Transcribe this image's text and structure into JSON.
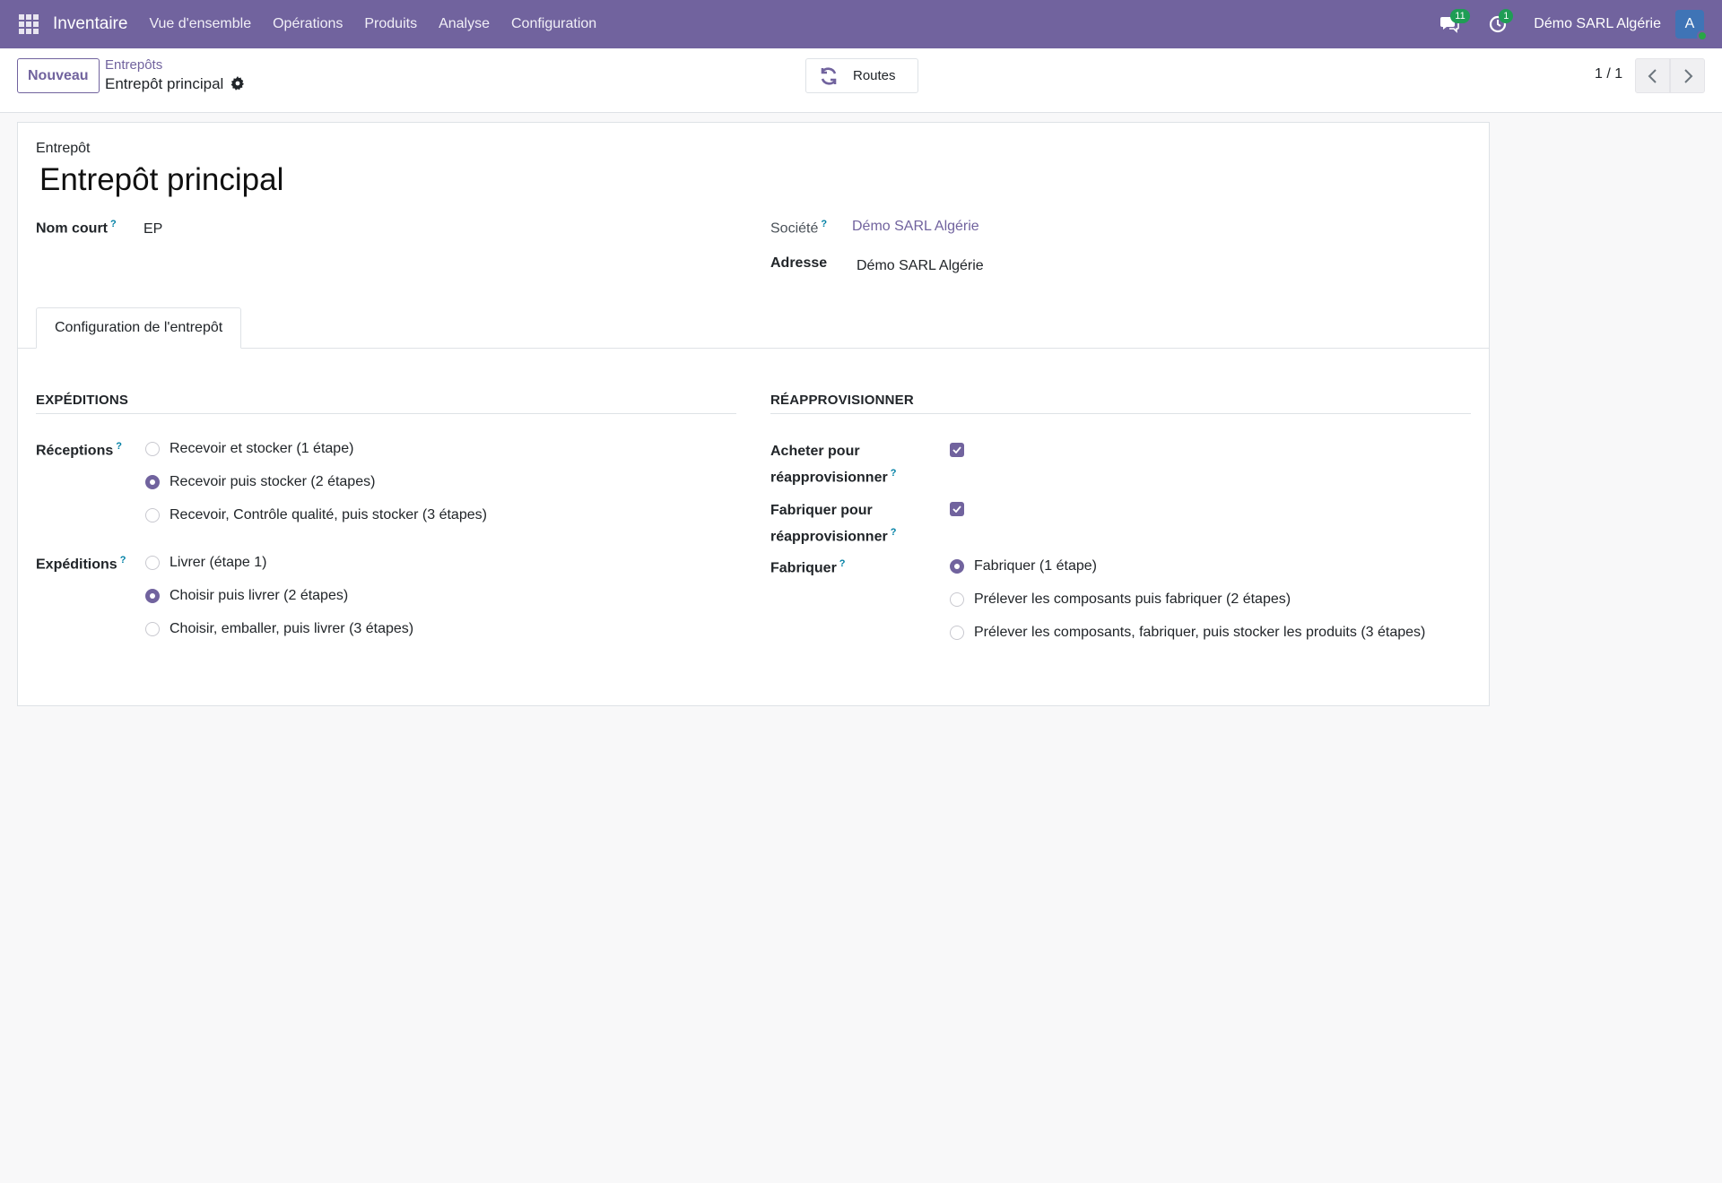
{
  "navbar": {
    "app_name": "Inventaire",
    "menu": [
      "Vue d'ensemble",
      "Opérations",
      "Produits",
      "Analyse",
      "Configuration"
    ],
    "messages_count": "11",
    "activities_count": "1",
    "company": "Démo SARL Algérie",
    "avatar_initial": "A"
  },
  "control_panel": {
    "new_label": "Nouveau",
    "breadcrumb_parent": "Entrepôts",
    "breadcrumb_current": "Entrepôt principal",
    "routes_label": "Routes",
    "pager": "1 / 1"
  },
  "form": {
    "record_type_label": "Entrepôt",
    "record_name": "Entrepôt principal",
    "short_name_label": "Nom court",
    "short_name_help": "?",
    "short_name_value": "EP",
    "company_label": "Société",
    "company_help": "?",
    "company_value": "Démo SARL Algérie",
    "address_label": "Adresse",
    "address_value": "Démo SARL Algérie",
    "tab_label": "Configuration de l'entrepôt",
    "shipments_section": "EXPÉDITIONS",
    "receptions_label": "Réceptions",
    "receptions_help": "?",
    "receptions_options": [
      {
        "label": "Recevoir et stocker (1 étape)",
        "selected": false
      },
      {
        "label": "Recevoir puis stocker (2 étapes)",
        "selected": true
      },
      {
        "label": "Recevoir, Contrôle qualité, puis stocker (3 étapes)",
        "selected": false
      }
    ],
    "deliveries_label": "Expéditions",
    "deliveries_help": "?",
    "deliveries_options": [
      {
        "label": "Livrer (étape 1)",
        "selected": false
      },
      {
        "label": "Choisir puis livrer (2 étapes)",
        "selected": true
      },
      {
        "label": "Choisir, emballer, puis livrer (3 étapes)",
        "selected": false
      }
    ],
    "resupply_section": "RÉAPPROVISIONNER",
    "buy_label_line1": "Acheter pour",
    "buy_label_line2": "réapprovisionner",
    "buy_help": "?",
    "buy_checked": true,
    "manufacture_resupply_label_line1": "Fabriquer pour",
    "manufacture_resupply_label_line2": "réapprovisionner",
    "manufacture_resupply_help": "?",
    "manufacture_resupply_checked": true,
    "manufacture_label": "Fabriquer",
    "manufacture_help": "?",
    "manufacture_options": [
      {
        "label": "Fabriquer (1 étape)",
        "selected": true
      },
      {
        "label": "Prélever les composants puis fabriquer (2 étapes)",
        "selected": false
      },
      {
        "label": "Prélever les composants, fabriquer, puis stocker les produits (3 étapes)",
        "selected": false
      }
    ]
  },
  "colors": {
    "brand": "#71639e",
    "badge": "#1f9d55",
    "help": "#0180a5"
  }
}
